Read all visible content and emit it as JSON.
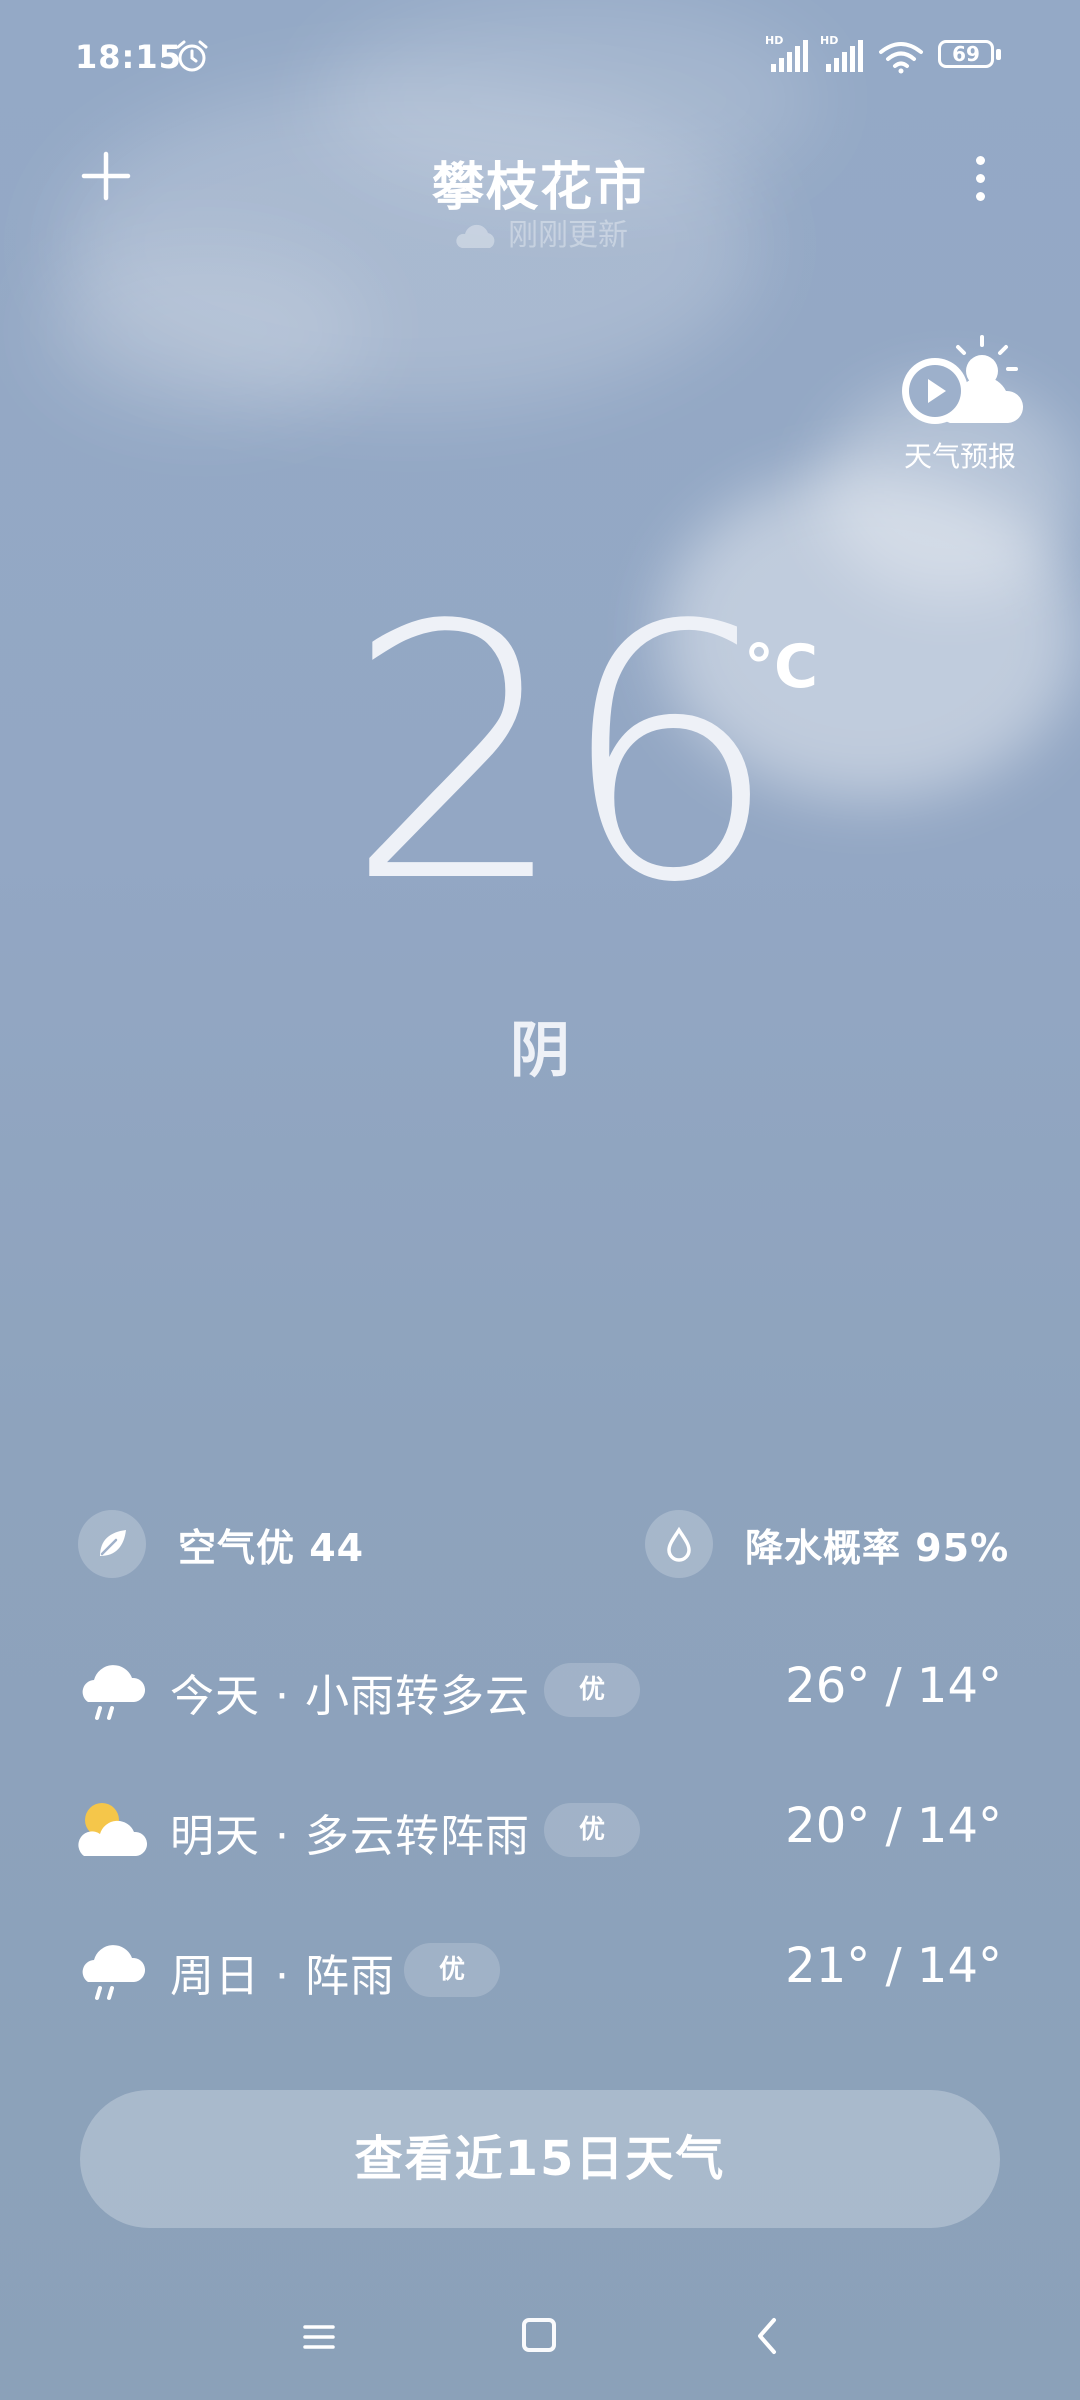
{
  "status_bar": {
    "time": "18:15",
    "signal_label": "HD",
    "battery": "69"
  },
  "header": {
    "city": "攀枝花市",
    "update_status": "刚刚更新"
  },
  "video_forecast": {
    "label": "天气预报"
  },
  "current": {
    "temperature": "26",
    "unit": "°C",
    "condition": "阴"
  },
  "metrics": {
    "air_quality": "空气优 44",
    "precipitation": "降水概率 95%"
  },
  "forecast": [
    {
      "label": "今天 · 小雨转多云",
      "badge": "优",
      "temps": "26° / 14°",
      "icon": "cloud-rain-icon"
    },
    {
      "label": "明天 · 多云转阵雨",
      "badge": "优",
      "temps": "20° / 14°",
      "icon": "partly-cloudy-icon"
    },
    {
      "label": "周日 · 阵雨",
      "badge": "优",
      "temps": "21° / 14°",
      "icon": "cloud-rain-icon"
    }
  ],
  "cta": {
    "label": "查看近15日天气"
  },
  "colors": {
    "background": "#93a7c4",
    "text": "#ffffff",
    "sun": "#f5c64a"
  }
}
